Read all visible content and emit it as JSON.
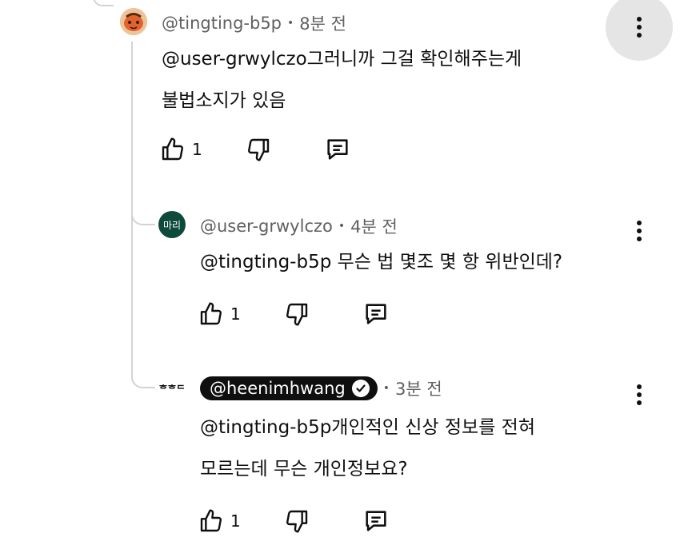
{
  "comments": [
    {
      "handle": "@tingting-b5p",
      "time": "8분 전",
      "lines": [
        "@user-grwylczo그러니까 그걸 확인해주는게",
        "불법소지가 있음"
      ],
      "likes": "1"
    },
    {
      "handle": "@user-grwylczo",
      "avatar_text": "마리",
      "time": "4분 전",
      "lines": [
        "@tingting-b5p 무슨 법 몇조 몇 항 위반인데?"
      ],
      "likes": "1"
    },
    {
      "handle": "@heenimhwang",
      "avatar_text": "ᄒᄒᄃ",
      "time": "3분 전",
      "lines": [
        "@tingting-b5p개인적인 신상 정보를 전혀",
        "모르는데 무슨 개인정보요?"
      ],
      "likes": "1",
      "verified": true
    }
  ],
  "colors": {
    "text": "#0f0f0f",
    "meta": "#606060",
    "thread_line": "#d3d3d3",
    "avatar_teal": "#0d4a3c",
    "kebab_highlight": "#e5e5e5"
  },
  "icons": [
    "thumb-up-icon",
    "thumb-down-icon",
    "reply-icon",
    "more-vert-icon",
    "verified-check-icon"
  ]
}
